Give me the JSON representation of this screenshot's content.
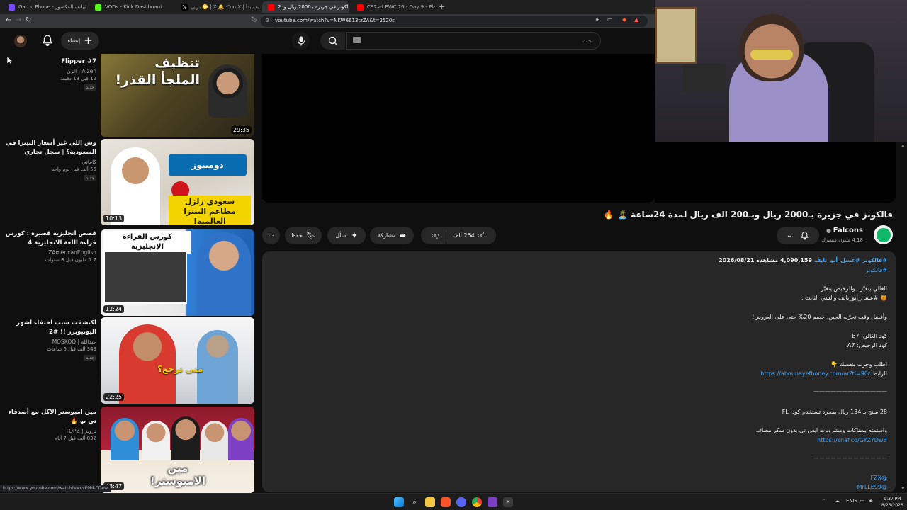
{
  "browser": {
    "tabs": [
      {
        "title": "Gartic Phone - لعبة الهاتف المكسور",
        "active": false,
        "color": "#7b4cff"
      },
      {
        "title": "VODs - Kick Dashboard",
        "active": false,
        "color": "#53fc18"
      },
      {
        "title": "برين 🙄 | X 🔔 :\"on X | أحداث كيف بدأ ...",
        "active": false,
        "color": "#ffffff"
      },
      {
        "title": "فالكونز في جزيرة بـ2000 ريال وبـ2...",
        "active": true,
        "color": "#ff0000"
      },
      {
        "title": "CS2 at EWC 26 - Day 9 - Playoffs - Yo",
        "active": false,
        "color": "#ff0000"
      }
    ],
    "url": "youtube.com/watch?v=NKW6613tzZA&t=2520s",
    "status_url": "https://www.youtube.com/watch?v=cvF9bl-CDew"
  },
  "header": {
    "create_label": "إنشاء",
    "search_placeholder": "بحث"
  },
  "recommendations": [
    {
      "title": "Flipper #7",
      "channel": "Alzen | الزن",
      "meta": "12 قبل 18 دقيقة",
      "badge": "جديد",
      "duration": "29:35",
      "thumb_text": "تنظيف الملجأ القذر!"
    },
    {
      "title": "وش اللي غير أسعار البيتزا في السعودية؟ | سجل تجاري",
      "channel": "كاماتي",
      "meta": "55 ألف قبل يوم واحد",
      "badge": "جديد",
      "duration": "10:13",
      "thumb_text": "سعودي زلزل مطاعم البيتزا العالمية!"
    },
    {
      "title": "قصص انجليزية قصيرة : كورس قراءة اللغة الانجليزية 4",
      "channel": "ZAmericanEnglish",
      "meta": "1.7 مليون قبل 8 سنوات",
      "badge": "",
      "duration": "12:24",
      "thumb_text": "كورس القراءة الإنجليزية"
    },
    {
      "title": "اكتشفت سبب اختفاء اشهر اليوتيوبرز !! #2",
      "channel": "عبدالله | MOSKOO",
      "meta": "349 ألف قبل 6 ساعات",
      "badge": "جديد",
      "duration": "22:25",
      "thumb_text": "متى ترجع؟"
    },
    {
      "title": "مين امبوستر الاكل مع أصدقاء تي يو 🔥",
      "channel": "تروبز | TOPZ",
      "meta": "832 ألف قبل 7 أيام",
      "badge": "",
      "duration": "48:47",
      "thumb_text": "مين الامبوستر!"
    }
  ],
  "video": {
    "title": "فالكونز في جزيرة بـ2000 ريال وبـ200 الف ريال لمدة 24ساعة 🏝️ 🔥",
    "channel": "Falcons",
    "subscribers": "4.18 مليون مشترك",
    "likes": "254 ألف",
    "share_label": "مشاركة",
    "ask_label": "اسأل",
    "save_label": "حفظ"
  },
  "description": {
    "stats": "4,090,159 مشاهدة  2026/08/21",
    "hashtags": "#فالكونز #عسل_أبو_نايف",
    "hashtags2": "#فالكونز",
    "lines": [
      "الغالي يتغيّر.. والرخيص يتغيّر",
      "🍯 #عسل_أبو_نايف والشي الثابت :",
      "وأفضل وقت تجرّبه الحين..خصم 20% حتى على العروض!",
      "كود الغالي: B7",
      "كود الرخيص: A7",
      "اطلب وجرب بنفسك 👇",
      "الرابط:",
      "—————————————",
      "28 منتج بـ 134 ريال بمجرد تستخدم كود: FL",
      "واستمتع بسناكات ومشروبات ايس تي بدون سكر مضاف",
      "—————————————",
      "@FZX",
      "@MrLLE99"
    ],
    "link1": "https://abounayefhoney.com/ar?ti=90r",
    "link2": "https://snaf.co/GYZYDwB"
  },
  "taskbar": {
    "lang": "ENG",
    "time": "9:37 PM",
    "date": "8/23/2026"
  }
}
